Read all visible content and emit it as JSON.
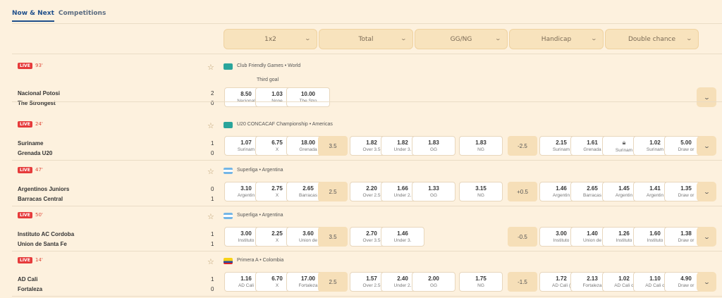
{
  "tabs": [
    {
      "label": "Now & Next"
    },
    {
      "label": "Competitions"
    }
  ],
  "markets": [
    "1x2",
    "Total",
    "GG/NG",
    "Handicap",
    "Double chance"
  ],
  "live_label": "LIVE",
  "matches": [
    {
      "minute": "93'",
      "competition": "Club Friendly Games • World",
      "flag": "world",
      "home": "Nacional Potosi",
      "away": "The Strongest",
      "home_score": "2",
      "away_score": "0",
      "note": "Third goal",
      "odds_1x2": [
        {
          "v": "8.50",
          "l": "Nacional"
        },
        {
          "v": "1.03",
          "l": "None"
        },
        {
          "v": "10.00",
          "l": "The Stro"
        }
      ]
    },
    {
      "minute": "24'",
      "competition": "U20 CONCACAF Championship • Americas",
      "flag": "world",
      "home": "Suriname",
      "away": "Grenada U20",
      "home_score": "1",
      "away_score": "0",
      "odds_1x2": [
        {
          "v": "1.07",
          "l": "Surinam"
        },
        {
          "v": "6.75",
          "l": "X"
        },
        {
          "v": "18.00",
          "l": "Grenada"
        }
      ],
      "total_line": "3.5",
      "odds_total": [
        {
          "v": "1.82",
          "l": "Over 3.5"
        },
        {
          "v": "1.82",
          "l": "Under 3."
        }
      ],
      "odds_gg": [
        {
          "v": "1.83",
          "l": "GG"
        },
        {
          "v": "1.83",
          "l": "NG"
        }
      ],
      "hcp_line": "-2.5",
      "odds_hcp": [
        {
          "v": "2.15",
          "l": "Surinam"
        },
        {
          "v": "1.61",
          "l": "Grenada"
        }
      ],
      "odds_dc": [
        {
          "v": "",
          "l": "Surinam",
          "lock": true
        },
        {
          "v": "1.02",
          "l": "Surinam"
        },
        {
          "v": "5.00",
          "l": "Draw or"
        }
      ]
    },
    {
      "minute": "47'",
      "competition": "Superliga • Argentina",
      "flag": "argentina",
      "home": "Argentinos Juniors",
      "away": "Barracas Central",
      "home_score": "0",
      "away_score": "1",
      "odds_1x2": [
        {
          "v": "3.10",
          "l": "Argentin"
        },
        {
          "v": "2.75",
          "l": "X"
        },
        {
          "v": "2.65",
          "l": "Barracas"
        }
      ],
      "total_line": "2.5",
      "odds_total": [
        {
          "v": "2.20",
          "l": "Over 2.5"
        },
        {
          "v": "1.66",
          "l": "Under 2."
        }
      ],
      "odds_gg": [
        {
          "v": "1.33",
          "l": "GG"
        },
        {
          "v": "3.15",
          "l": "NG"
        }
      ],
      "hcp_line": "+0.5",
      "odds_hcp": [
        {
          "v": "1.46",
          "l": "Argentin"
        },
        {
          "v": "2.65",
          "l": "Barracas"
        }
      ],
      "odds_dc": [
        {
          "v": "1.45",
          "l": "Argentin"
        },
        {
          "v": "1.41",
          "l": "Argentin"
        },
        {
          "v": "1.35",
          "l": "Draw or"
        }
      ]
    },
    {
      "minute": "50'",
      "competition": "Superliga • Argentina",
      "flag": "argentina",
      "home": "Instituto AC Cordoba",
      "away": "Union de Santa Fe",
      "home_score": "1",
      "away_score": "1",
      "odds_1x2": [
        {
          "v": "3.00",
          "l": "Instituto"
        },
        {
          "v": "2.25",
          "l": "X"
        },
        {
          "v": "3.60",
          "l": "Union de"
        }
      ],
      "total_line": "3.5",
      "odds_total": [
        {
          "v": "2.70",
          "l": "Over 3.5"
        },
        {
          "v": "1.46",
          "l": "Under 3."
        }
      ],
      "hcp_line": "-0.5",
      "odds_hcp": [
        {
          "v": "3.00",
          "l": "Instituto"
        },
        {
          "v": "1.40",
          "l": "Union de"
        }
      ],
      "odds_dc": [
        {
          "v": "1.26",
          "l": "Instituto"
        },
        {
          "v": "1.60",
          "l": "Instituto"
        },
        {
          "v": "1.38",
          "l": "Draw or"
        }
      ]
    },
    {
      "minute": "14'",
      "competition": "Primera A • Colombia",
      "flag": "colombia",
      "home": "AD Cali",
      "away": "Fortaleza",
      "home_score": "1",
      "away_score": "0",
      "odds_1x2": [
        {
          "v": "1.16",
          "l": "AD Cali"
        },
        {
          "v": "6.70",
          "l": "X"
        },
        {
          "v": "17.00",
          "l": "Fortaleza"
        }
      ],
      "total_line": "2.5",
      "odds_total": [
        {
          "v": "1.57",
          "l": "Over 2.5"
        },
        {
          "v": "2.40",
          "l": "Under 2."
        }
      ],
      "odds_gg": [
        {
          "v": "2.00",
          "l": "GG"
        },
        {
          "v": "1.75",
          "l": "NG"
        }
      ],
      "hcp_line": "-1.5",
      "odds_hcp": [
        {
          "v": "1.72",
          "l": "AD Cali ("
        },
        {
          "v": "2.13",
          "l": "Fortaleza"
        }
      ],
      "odds_dc": [
        {
          "v": "1.02",
          "l": "AD Cali o"
        },
        {
          "v": "1.10",
          "l": "AD Cali o"
        },
        {
          "v": "4.90",
          "l": "Draw or"
        }
      ]
    }
  ]
}
